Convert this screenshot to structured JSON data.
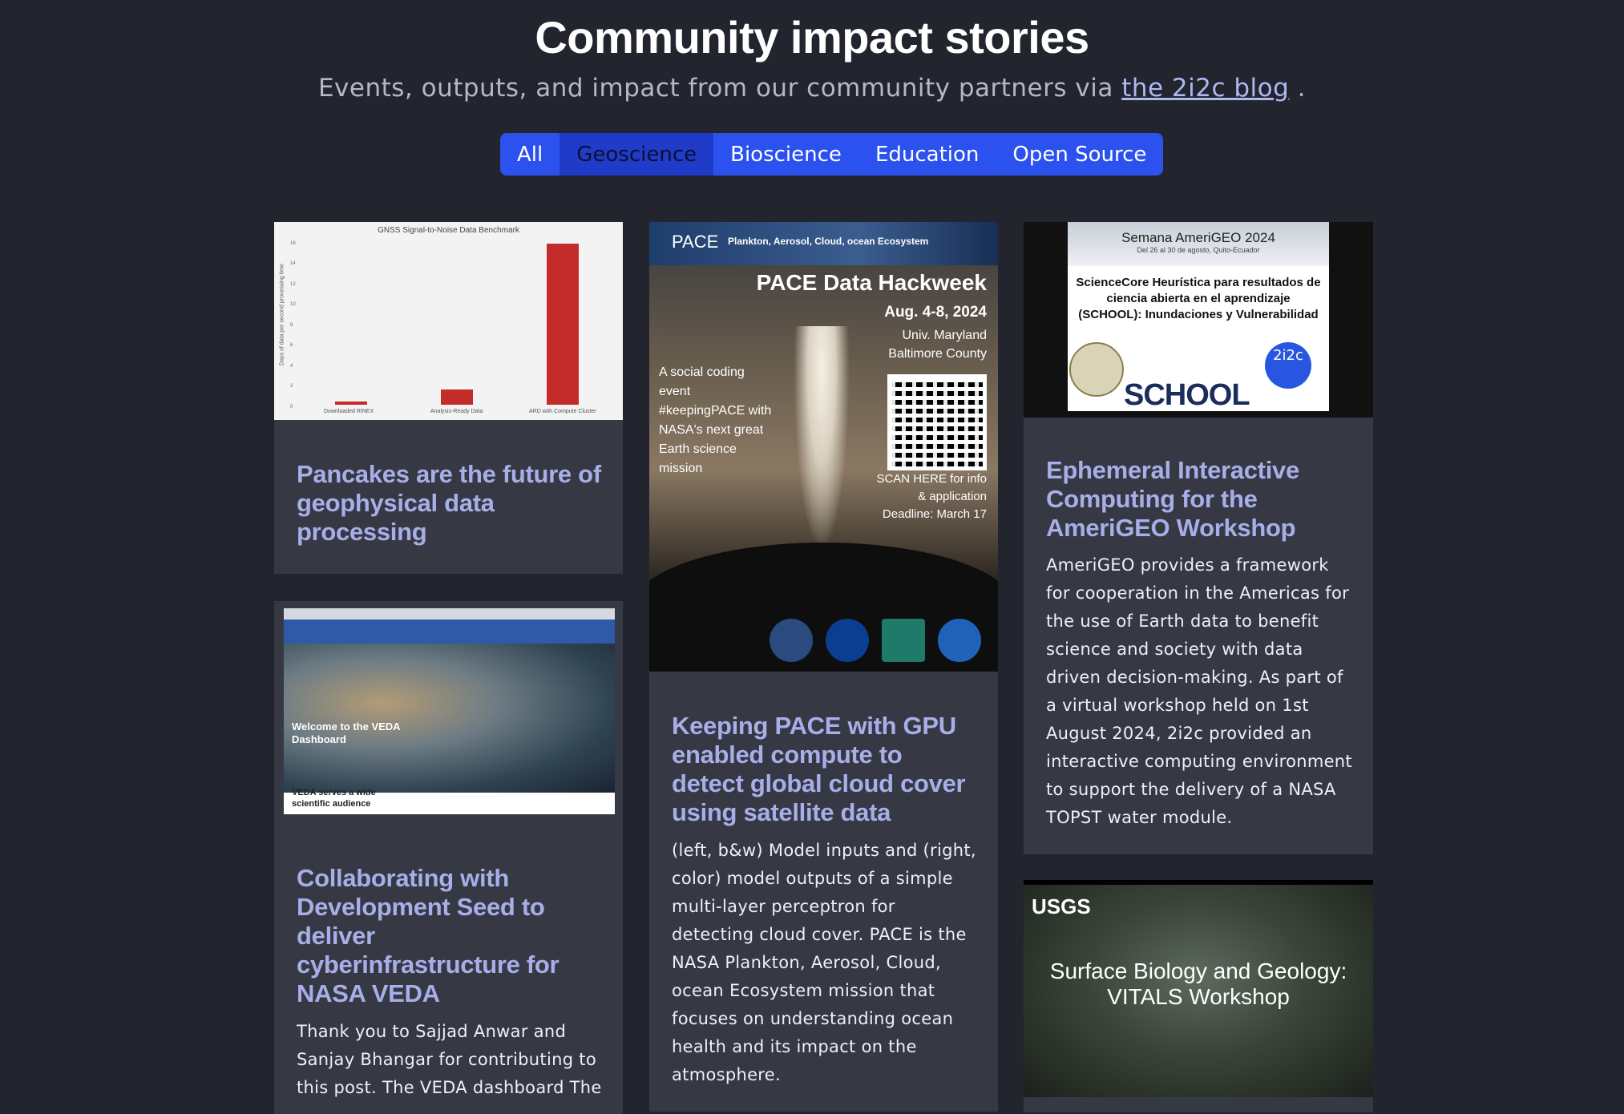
{
  "header": {
    "title": "Community impact stories",
    "subtitle_prefix": "Events, outputs, and impact from our community partners via ",
    "blog_link": "the 2i2c blog",
    "subtitle_suffix": " ."
  },
  "tabs": [
    {
      "label": "All",
      "active": false
    },
    {
      "label": "Geoscience",
      "active": true
    },
    {
      "label": "Bioscience",
      "active": false
    },
    {
      "label": "Education",
      "active": false
    },
    {
      "label": "Open Source",
      "active": false
    }
  ],
  "cards": {
    "pancakes": {
      "title": "Pancakes are the future of geophysical data processing",
      "image": {
        "chart_title": "GNSS Signal-to-Noise Data Benchmark",
        "ylabel": "Days of data per second processing time",
        "yticks": [
          "16",
          "14",
          "12",
          "10",
          "8",
          "6",
          "4",
          "2",
          "0"
        ],
        "categories": [
          "Downloaded RINEX",
          "Analysis-Ready Data",
          "ARD with Compute Cluster"
        ],
        "values": [
          0.3,
          1.5,
          15.8
        ]
      }
    },
    "pace": {
      "title": "Keeping PACE with GPU enabled compute to detect global cloud cover using satellite data",
      "body": "(left, b&w) Model inputs and (right, color) model outputs of a simple multi-layer perceptron for detecting cloud cover. PACE is the NASA Plankton, Aerosol, Cloud, ocean Ecosystem mission that focuses on understanding ocean health and its impact on the atmosphere.",
      "image": {
        "logo": "PACE",
        "banner": "Plankton, Aerosol, Cloud, ocean Ecosystem",
        "headline": "PACE Data Hackweek",
        "dates": "Aug. 4-8, 2024",
        "location": "Univ. Maryland Baltimore County",
        "tagline": "A social coding event #keepingPACE with NASA's next great Earth science mission",
        "scan": "SCAN HERE for info & application Deadline: March 17"
      }
    },
    "amerigeo": {
      "title": "Ephemeral Interactive Computing for the AmeriGEO Workshop",
      "body": "AmeriGEO provides a framework for cooperation in the Americas for the use of Earth data to benefit science and society with data driven decision-making. As part of a virtual workshop held on 1st August 2024, 2i2c provided an interactive computing environment to support the delivery of a NASA TOPST water module.",
      "image": {
        "slide_header": "Semana AmeriGEO 2024",
        "slide_sub": "Del 26 al 30 de agosto, Quito-Ecuador",
        "slide_title": "ScienceCore Heurística para resultados de ciencia abierta en el aprendizaje (SCHOOL): Inundaciones y Vulnerabilidad",
        "wordmark": "SCHOOL",
        "badge": "2i2c"
      }
    },
    "veda": {
      "title": "Collaborating with Development Seed to deliver cyberinfrastructure for NASA VEDA",
      "body": "Thank you to Sajjad Anwar and Sanjay Bhangar for contributing to this post. The VEDA dashboard The",
      "image": {
        "hero_text": "Welcome to the VEDA Dashboard",
        "lower_text": "VEDA serves a wide scientific audience"
      }
    },
    "usgs": {
      "image": {
        "logo": "USGS",
        "slide_title": "Surface Biology and Geology: VITALS Workshop"
      }
    }
  },
  "colors": {
    "background": "#22252e",
    "card": "#363944",
    "title_link": "#a7aee8",
    "tab_bg": "#2b51ee",
    "tab_active": "#1f3bc7"
  }
}
